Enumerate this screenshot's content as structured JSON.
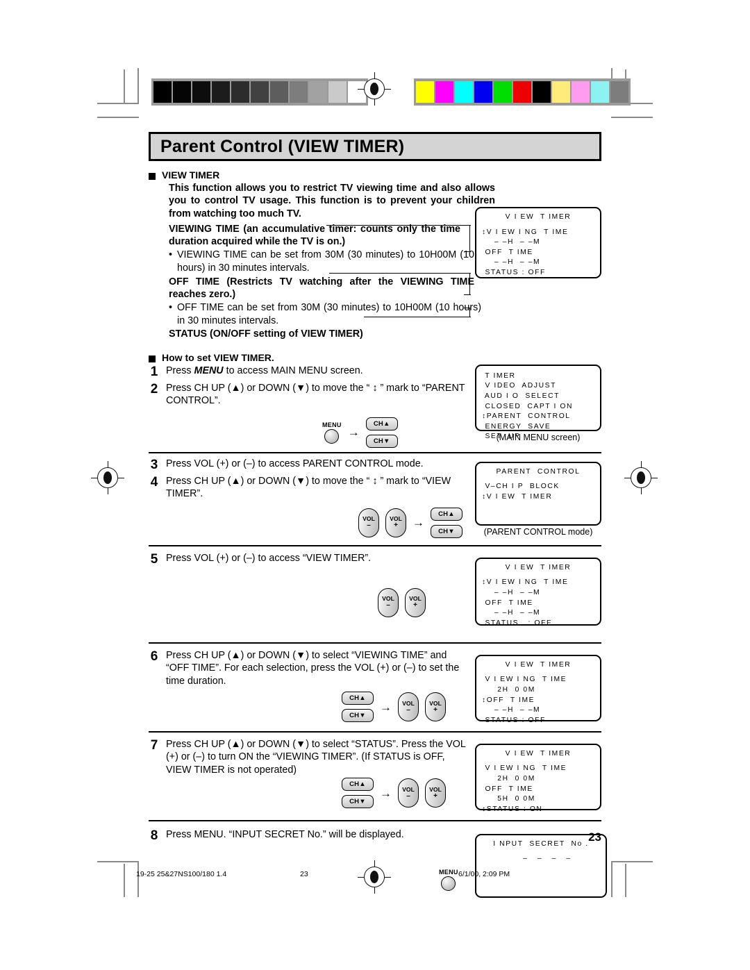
{
  "header": {
    "title": "Parent Control (VIEW TIMER)"
  },
  "intro": {
    "heading": "VIEW TIMER",
    "paragraph1": "This function allows you to restrict TV viewing time and also allows you to control TV usage. This function is to prevent your children from watching too much TV.",
    "viewing_time_def": "VIEWING TIME (an accumulative timer: counts only the time duration acquired while the TV is on.)",
    "bullet1": "VIEWING TIME can be set from 30M (30 minutes) to 10H00M (10 hours) in 30 minutes intervals.",
    "off_time_def": "OFF TIME (Restricts TV watching after the VIEWING TIME reaches zero.)",
    "bullet2": "OFF TIME can be set from 30M (30 minutes) to 10H00M (10 hours) in 30 minutes intervals.",
    "status_def": "STATUS (ON/OFF setting of VIEW TIMER)",
    "bullet_char": "•"
  },
  "howto": {
    "heading": "How to set VIEW TIMER."
  },
  "steps": [
    {
      "num": "1",
      "text_parts": [
        "Press ",
        "MENU",
        " to access MAIN MENU screen."
      ]
    },
    {
      "num": "2",
      "text": "Press CH UP (▲) or DOWN (▼) to move the “ ↕ ” mark to “PARENT CONTROL”."
    },
    {
      "num": "3",
      "text": "Press VOL (+) or (–) to access PARENT CONTROL mode."
    },
    {
      "num": "4",
      "text": "Press CH UP (▲) or DOWN (▼) to move the “ ↕ ” mark to “VIEW TIMER”."
    },
    {
      "num": "5",
      "text": "Press VOL (+) or (–) to access “VIEW TIMER”."
    },
    {
      "num": "6",
      "text": "Press CH UP (▲) or DOWN (▼) to select “VIEWING TIME” and “OFF TIME”. For each selection, press the VOL (+) or (–) to set the time duration."
    },
    {
      "num": "7",
      "text": "Press CH UP (▲) or DOWN (▼) to select “STATUS”. Press the VOL (+) or (–) to turn ON the “VIEWING TIMER”. (If STATUS is OFF, VIEW TIMER is not operated)"
    },
    {
      "num": "8",
      "text": "Press MENU. “INPUT SECRET No.” will be displayed."
    }
  ],
  "keys": {
    "menu_label": "MENU",
    "ch_up": "CH▲",
    "ch_down": "CH▼",
    "vol_label": "VOL",
    "vol_minus": "–",
    "vol_plus": "+",
    "arrow": "→"
  },
  "osd_screens": {
    "view_timer_empty": {
      "title": "V I EW  T IMER",
      "lines": [
        "↕V I EW I NG  T IME",
        "    – –H  – –M",
        " OFF  T IME",
        "    – –H  – –M",
        " STATUS : OFF"
      ]
    },
    "main_menu": {
      "lines": [
        " T IMER",
        " V IDEO  ADJUST",
        " AUD I O  SELECT",
        " CLOSED  CAPT I ON",
        "↕PARENT  CONTROL",
        " ENERGY  SAVE",
        " SET  UP"
      ],
      "caption": "(MAIN MENU screen)"
    },
    "parent_control": {
      "title": "PARENT  CONTROL",
      "lines": [
        " V–CH I P  BLOCK",
        "↕V I EW  T IMER"
      ],
      "caption": "(PARENT CONTROL mode)"
    },
    "view_timer_step5": {
      "title": "V I EW  T IMER",
      "lines": [
        "↕V I EW I NG  T IME",
        "    – –H  – –M",
        " OFF  T IME",
        "    – –H  – –M",
        " STATUS   : OFF"
      ]
    },
    "view_timer_step6": {
      "title": "V I EW  T IMER",
      "lines": [
        " V I EW I NG  T IME",
        "     2H  0 0M",
        "↕OFF  T IME",
        "    – –H  – –M",
        " STATUS : OFF"
      ]
    },
    "view_timer_step7": {
      "title": "V I EW  T IMER",
      "lines": [
        " V I EW I NG  T IME",
        "     2H  0 0M",
        " OFF  T IME",
        "     5H  0 0M",
        "↕STATUS : ON"
      ]
    },
    "input_secret": {
      "title": "I NPUT  SECRET  No .",
      "lines": [
        "    –   –   –   –"
      ]
    }
  },
  "color_bars": {
    "grayscale": [
      "#000000",
      "#050505",
      "#0d0d0d",
      "#1c1c1c",
      "#2c2c2c",
      "#414141",
      "#5d5d5d",
      "#7d7d7d",
      "#a2a2a2",
      "#cacaca",
      "#ffffff"
    ],
    "colors": [
      "#ffff00",
      "#ff00ff",
      "#00ffff",
      "#0000f0",
      "#00dd00",
      "#ee0000",
      "#000000",
      "#ffeb7a",
      "#ff9cf0",
      "#8cf2f2",
      "#7d7d7d"
    ]
  },
  "footer": {
    "page_number": "23",
    "file_ref": "19-25 25&27NS100/180 1.4",
    "footer_page": "23",
    "timestamp": "6/1/00, 2:09 PM"
  }
}
